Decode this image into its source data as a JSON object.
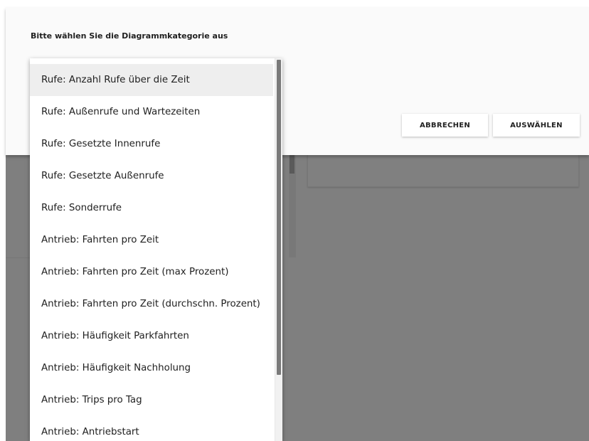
{
  "dialog": {
    "title": "Bitte wählen Sie die Diagrammkategorie aus",
    "cancel_label": "ABBRECHEN",
    "select_label": "AUSWÄHLEN"
  },
  "dropdown": {
    "selected_index": 0,
    "options": [
      "Rufe: Anzahl Rufe über die Zeit",
      "Rufe: Außenrufe und Wartezeiten",
      "Rufe: Gesetzte Innenrufe",
      "Rufe: Gesetzte Außenrufe",
      "Rufe: Sonderrufe",
      "Antrieb: Fahrten pro Zeit",
      "Antrieb: Fahrten pro Zeit (max Prozent)",
      "Antrieb: Fahrten pro Zeit (durchschn. Prozent)",
      "Antrieb: Häufigkeit Parkfahrten",
      "Antrieb: Häufigkeit Nachholung",
      "Antrieb: Trips pro Tag",
      "Antrieb: Antriebstart"
    ]
  },
  "colors": {
    "overlay": "#7f7f7f",
    "dialog_background": "#fafafa",
    "selected_option": "#eeeeee",
    "text": "#212121"
  }
}
